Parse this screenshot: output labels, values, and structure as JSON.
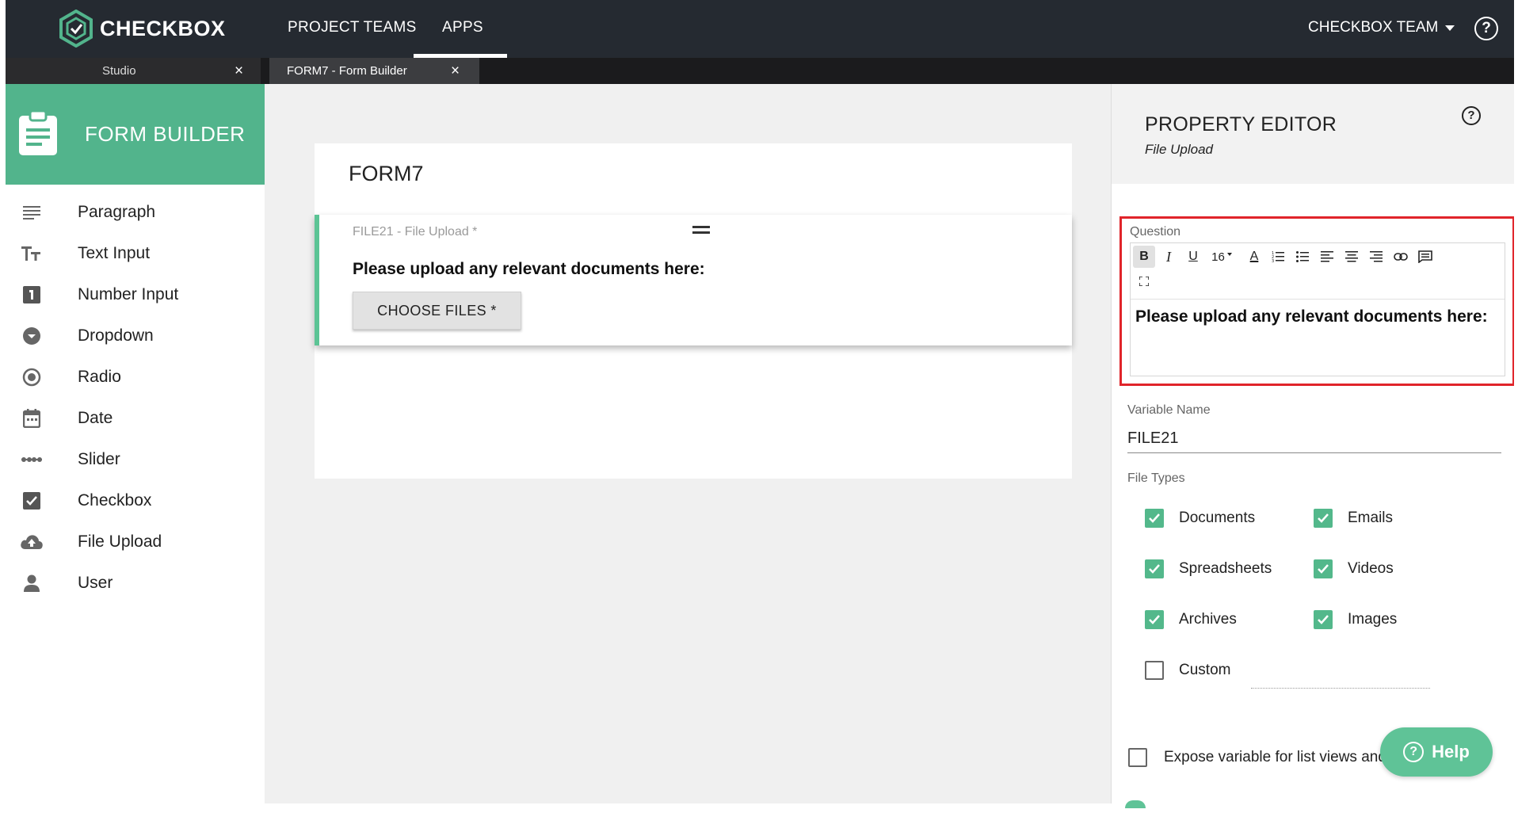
{
  "app": {
    "logo_text": "CHECKBOX",
    "nav": [
      "PROJECT TEAMS",
      "APPS"
    ],
    "team_menu": "CHECKBOX TEAM",
    "help_glyph": "?"
  },
  "tabs": [
    {
      "label": "Studio",
      "close": "×"
    },
    {
      "label": "FORM7 - Form Builder",
      "close": "×"
    }
  ],
  "sidebar": {
    "title": "FORM BUILDER",
    "items": [
      {
        "label": "Paragraph",
        "icon": "paragraph-icon"
      },
      {
        "label": "Text Input",
        "icon": "text-input-icon"
      },
      {
        "label": "Number Input",
        "icon": "number-input-icon"
      },
      {
        "label": "Dropdown",
        "icon": "dropdown-icon"
      },
      {
        "label": "Radio",
        "icon": "radio-icon"
      },
      {
        "label": "Date",
        "icon": "calendar-icon"
      },
      {
        "label": "Slider",
        "icon": "slider-icon"
      },
      {
        "label": "Checkbox",
        "icon": "checkbox-icon"
      },
      {
        "label": "File Upload",
        "icon": "cloud-upload-icon"
      },
      {
        "label": "User",
        "icon": "user-icon"
      }
    ]
  },
  "form": {
    "title": "FORM7",
    "question": {
      "meta": "FILE21 - File Upload *",
      "text": "Please upload any relevant documents here:",
      "button": "CHOOSE FILES *"
    }
  },
  "property_editor": {
    "title": "PROPERTY EDITOR",
    "subtitle": "File Upload",
    "question_label": "Question",
    "toolbar": {
      "bold": "B",
      "italic": "I",
      "underline": "U",
      "font_size": "16",
      "font_color": "A"
    },
    "question_text": "Please upload any relevant documents here:",
    "variable_name_label": "Variable Name",
    "variable_name": "FILE21",
    "file_types_label": "File Types",
    "file_types": [
      {
        "label": "Documents",
        "checked": true
      },
      {
        "label": "Emails",
        "checked": true
      },
      {
        "label": "Spreadsheets",
        "checked": true
      },
      {
        "label": "Videos",
        "checked": true
      },
      {
        "label": "Archives",
        "checked": true
      },
      {
        "label": "Images",
        "checked": true
      },
      {
        "label": "Custom",
        "checked": false
      }
    ],
    "expose_label": "Expose variable for list views and"
  },
  "help_button": "Help",
  "colors": {
    "brand_green": "#52b48c",
    "topbar": "#252a31",
    "highlight_red": "#e0242a"
  }
}
